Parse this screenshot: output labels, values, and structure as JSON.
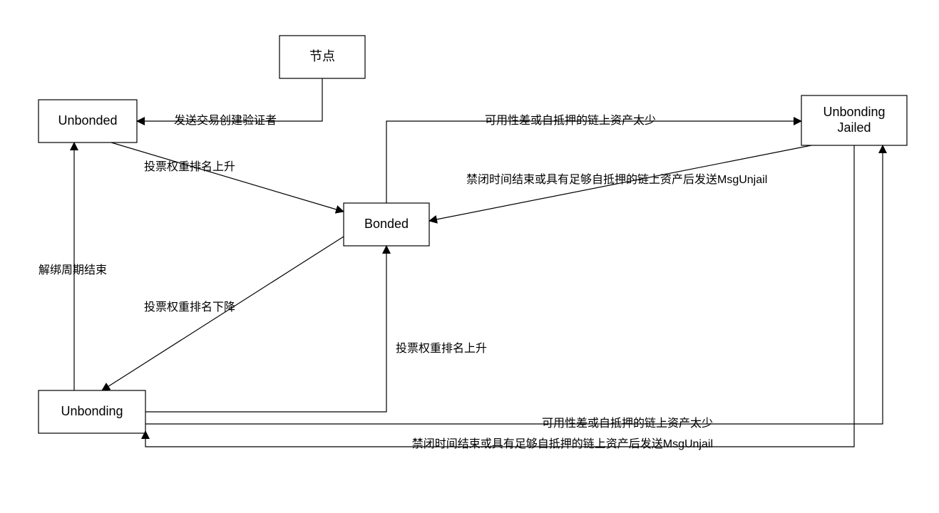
{
  "nodes": {
    "node_start": {
      "label": "节点"
    },
    "unbonded": {
      "label": "Unbonded"
    },
    "bonded": {
      "label": "Bonded"
    },
    "unbonding": {
      "label": "Unbonding"
    },
    "unbonding_jailed_l1": {
      "label": "Unbonding"
    },
    "unbonding_jailed_l2": {
      "label": "Jailed"
    }
  },
  "edges": {
    "node_to_unbonded": {
      "label": "发送交易创建验证者"
    },
    "unbonded_to_bonded": {
      "label": "投票权重排名上升"
    },
    "bonded_to_unbonding": {
      "label": "投票权重排名下降"
    },
    "unbonding_to_unbonded": {
      "label": "解绑周期结束"
    },
    "unbonding_to_bonded": {
      "label": "投票权重排名上升"
    },
    "bonded_to_jailed": {
      "label": "可用性差或自抵押的链上资产太少"
    },
    "jailed_to_bonded": {
      "label": "禁闭时间结束或具有足够自抵押的链上资产后发送MsgUnjail"
    },
    "unbonding_to_jailed": {
      "label": "可用性差或自抵押的链上资产太少"
    },
    "jailed_to_unbonding": {
      "label": "禁闭时间结束或具有足够自抵押的链上资产后发送MsgUnjail"
    }
  }
}
